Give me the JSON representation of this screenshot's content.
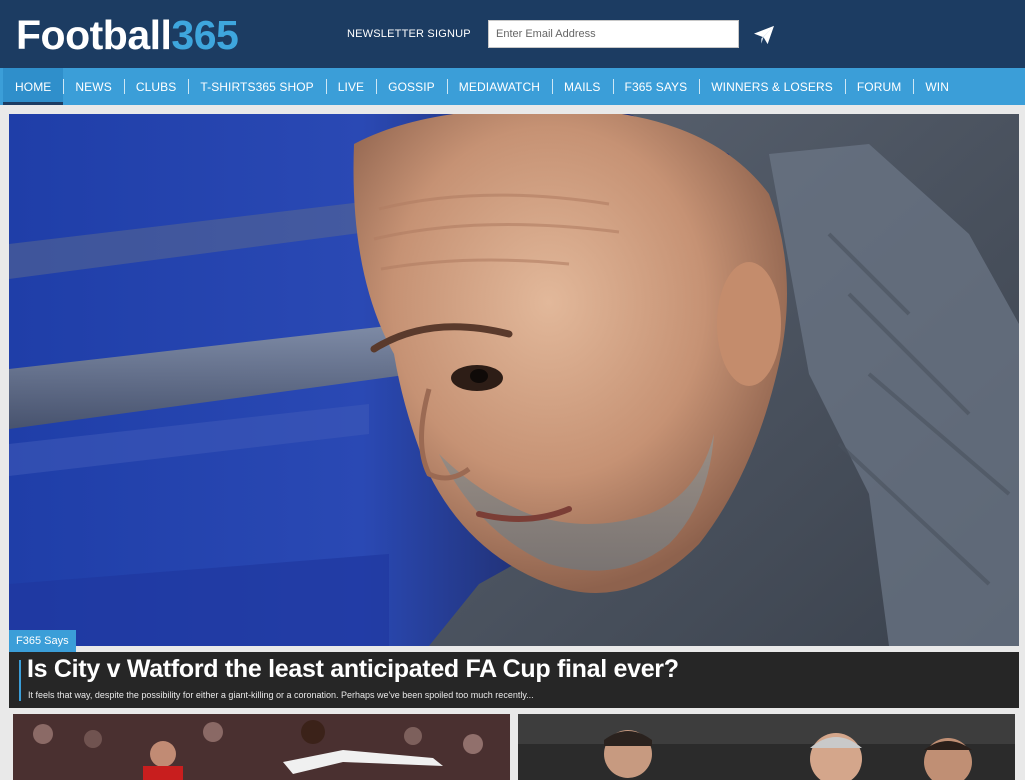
{
  "header": {
    "logo_part1": "Football",
    "logo_part2": "365",
    "newsletter_label": "NEWSLETTER SIGNUP",
    "email_placeholder": "Enter Email Address",
    "email_value": "",
    "send_icon": "paper-plane-icon"
  },
  "nav": {
    "items": [
      {
        "label": "HOME",
        "active": true
      },
      {
        "label": "NEWS"
      },
      {
        "label": "CLUBS"
      },
      {
        "label": "T-SHIRTS365 SHOP"
      },
      {
        "label": "LIVE"
      },
      {
        "label": "GOSSIP"
      },
      {
        "label": "MEDIAWATCH"
      },
      {
        "label": "MAILS"
      },
      {
        "label": "F365 SAYS"
      },
      {
        "label": "WINNERS & LOSERS"
      },
      {
        "label": "FORUM"
      },
      {
        "label": "WIN"
      }
    ]
  },
  "hero": {
    "tag": "F365 Says",
    "headline": "Is City v Watford the least anticipated FA Cup final ever?",
    "standfirst": "It feels that way, despite the possibility for either a giant-killing or a coronation. Perhaps we've been spoiled too much recently..."
  },
  "colors": {
    "header_bg": "#1c3c62",
    "nav_bg": "#3b9ed8",
    "accent": "#3ea6dd",
    "caption_bg": "#262626"
  }
}
